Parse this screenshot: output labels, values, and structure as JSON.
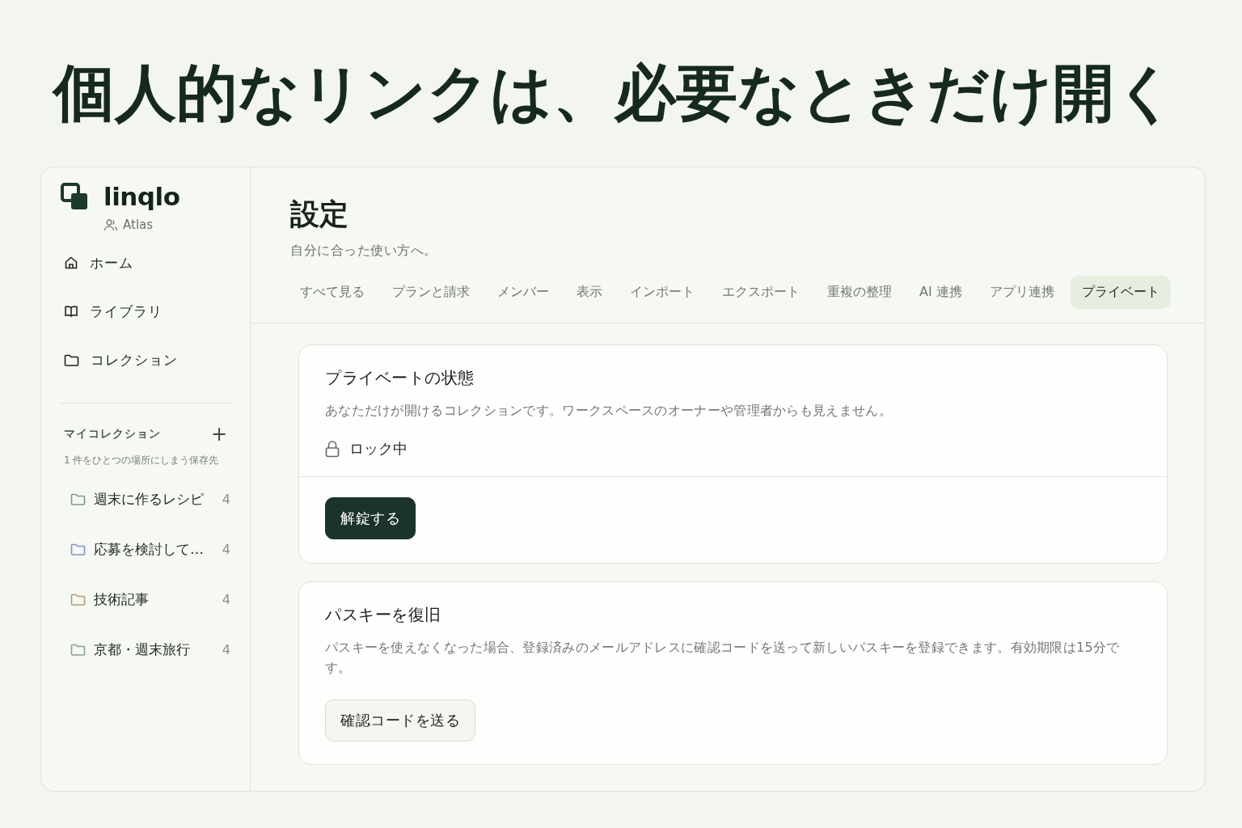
{
  "headline": "個人的なリンクは、必要なときだけ開く",
  "sidebar": {
    "brand": "linqlo",
    "workspace": "Atlas",
    "nav": [
      {
        "label": "ホーム",
        "kind": "home"
      },
      {
        "label": "ライブラリ",
        "kind": "book"
      },
      {
        "label": "コレクション",
        "kind": "folder"
      }
    ],
    "section": {
      "title": "マイコレクション",
      "add": "+",
      "hint": "1 件をひとつの場所にしまう保存先"
    },
    "collections": [
      {
        "name": "週末に作るレシピ",
        "count": "4",
        "color": "#7d9a88"
      },
      {
        "name": "応募を検討して…",
        "count": "4",
        "color": "#7f96c0"
      },
      {
        "name": "技術記事",
        "count": "4",
        "color": "#b49a7e"
      },
      {
        "name": "京都・週末旅行",
        "count": "4",
        "color": "#86a092"
      }
    ]
  },
  "page": {
    "title": "設定",
    "subtitle": "自分に合った使い方へ。"
  },
  "tabs": [
    {
      "label": "すべて見る",
      "selected": false
    },
    {
      "label": "プランと請求",
      "selected": false
    },
    {
      "label": "メンバー",
      "selected": false
    },
    {
      "label": "表示",
      "selected": false
    },
    {
      "label": "インポート",
      "selected": false
    },
    {
      "label": "エクスポート",
      "selected": false
    },
    {
      "label": "重複の整理",
      "selected": false
    },
    {
      "label": "AI 連携",
      "selected": false
    },
    {
      "label": "アプリ連携",
      "selected": false
    },
    {
      "label": "プライベート",
      "selected": true
    }
  ],
  "cards": [
    {
      "title": "プライベートの状態",
      "description": "あなただけが開けるコレクションです。ワークスペースのオーナーや管理者からも見えません。",
      "status": {
        "label": "ロック中",
        "locked": true
      },
      "button": {
        "label": "解錠する",
        "kind": "primary"
      }
    },
    {
      "title": "パスキーを復旧",
      "description": "パスキーを使えなくなった場合、登録済みのメールアドレスに確認コードを送って新しいパスキーを登録できます。有効期限は15分です。",
      "button": {
        "label": "確認コードを送る",
        "kind": "secondary"
      }
    }
  ]
}
